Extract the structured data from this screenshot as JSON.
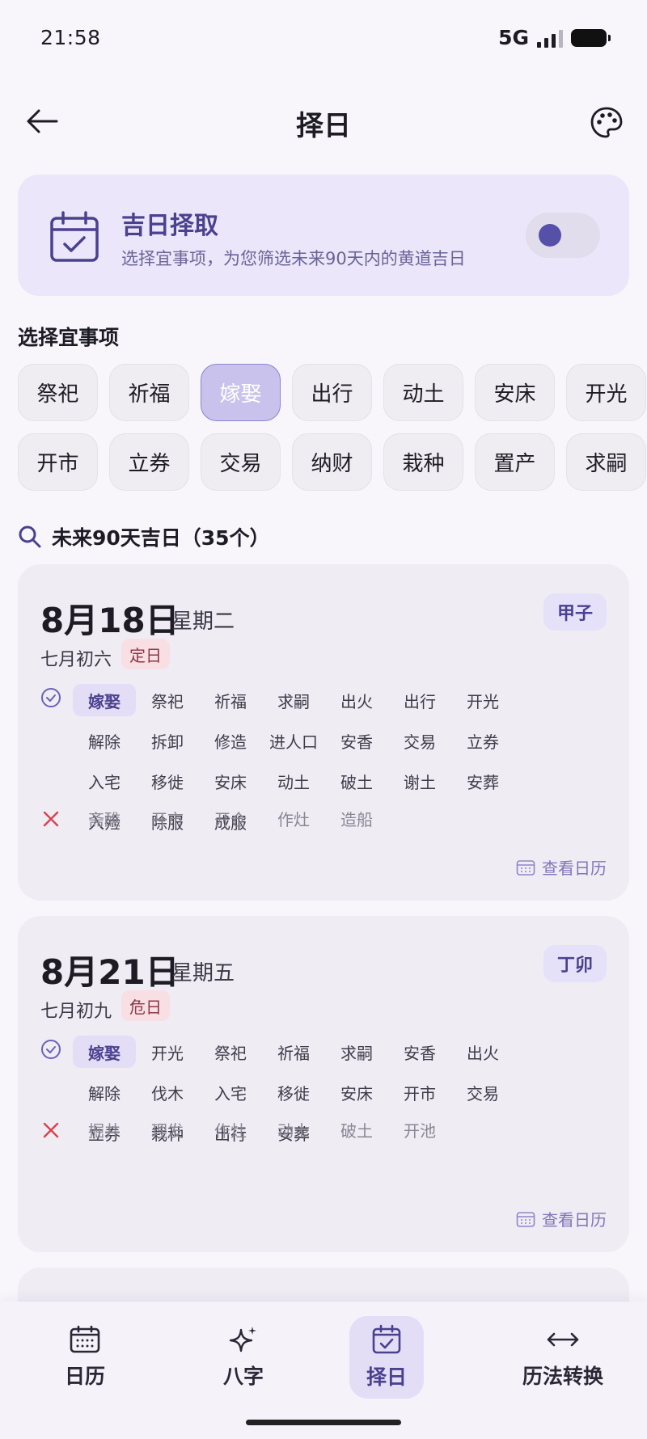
{
  "status_bar": {
    "time": "21:58",
    "network": "5G"
  },
  "header": {
    "title": "择日",
    "back_icon": "arrow-left-icon",
    "theme_icon": "palette-icon"
  },
  "banner": {
    "title": "吉日择取",
    "description": "选择宜事项，为您筛选未来90天内的黄道吉日",
    "icon": "calendar-check-icon",
    "toggle_on": false
  },
  "filter": {
    "label": "选择宜事项",
    "row1": [
      "祭祀",
      "祈福",
      "嫁娶",
      "出行",
      "动土",
      "安床",
      "开光"
    ],
    "row2": [
      "开市",
      "立券",
      "交易",
      "纳财",
      "栽种",
      "置产",
      "求嗣"
    ],
    "selected": "嫁娶"
  },
  "results": {
    "label": "未来90天吉日（35个）"
  },
  "days": [
    {
      "date": "8月18日",
      "weekday": "星期二",
      "ganzhi": "甲子",
      "lunar": "七月初六",
      "day_type": "定日",
      "good": [
        "嫁娶",
        "祭祀",
        "祈福",
        "求嗣",
        "出火",
        "出行",
        "开光",
        "解除",
        "拆卸",
        "修造",
        "进人口",
        "安香",
        "交易",
        "立券",
        "入宅",
        "移徙",
        "安床",
        "动土",
        "破土",
        "谢土",
        "安葬",
        "入殓",
        "除服",
        "成服"
      ],
      "bad": [
        "斋醮",
        "开市",
        "开仓",
        "作灶",
        "造船"
      ],
      "view_calendar": "查看日历"
    },
    {
      "date": "8月21日",
      "weekday": "星期五",
      "ganzhi": "丁卯",
      "lunar": "七月初九",
      "day_type": "危日",
      "good": [
        "嫁娶",
        "开光",
        "祭祀",
        "祈福",
        "求嗣",
        "安香",
        "出火",
        "解除",
        "伐木",
        "入宅",
        "移徙",
        "安床",
        "开市",
        "交易",
        "立券",
        "栽种",
        "出行",
        "安葬"
      ],
      "bad": [
        "掘井",
        "理发",
        "作灶",
        "动土",
        "破土",
        "开池"
      ],
      "view_calendar": "查看日历"
    }
  ],
  "bottom_nav": [
    {
      "label": "日历",
      "icon": "calendar-grid-icon",
      "active": false
    },
    {
      "label": "八字",
      "icon": "sparkle-icon",
      "active": false
    },
    {
      "label": "择日",
      "icon": "calendar-check-icon",
      "active": true
    },
    {
      "label": "历法转换",
      "icon": "swap-horizontal-icon",
      "active": false
    }
  ],
  "colors": {
    "accent": "#4a418f",
    "accent_light": "#e3def6",
    "bad": "#d9414f"
  }
}
